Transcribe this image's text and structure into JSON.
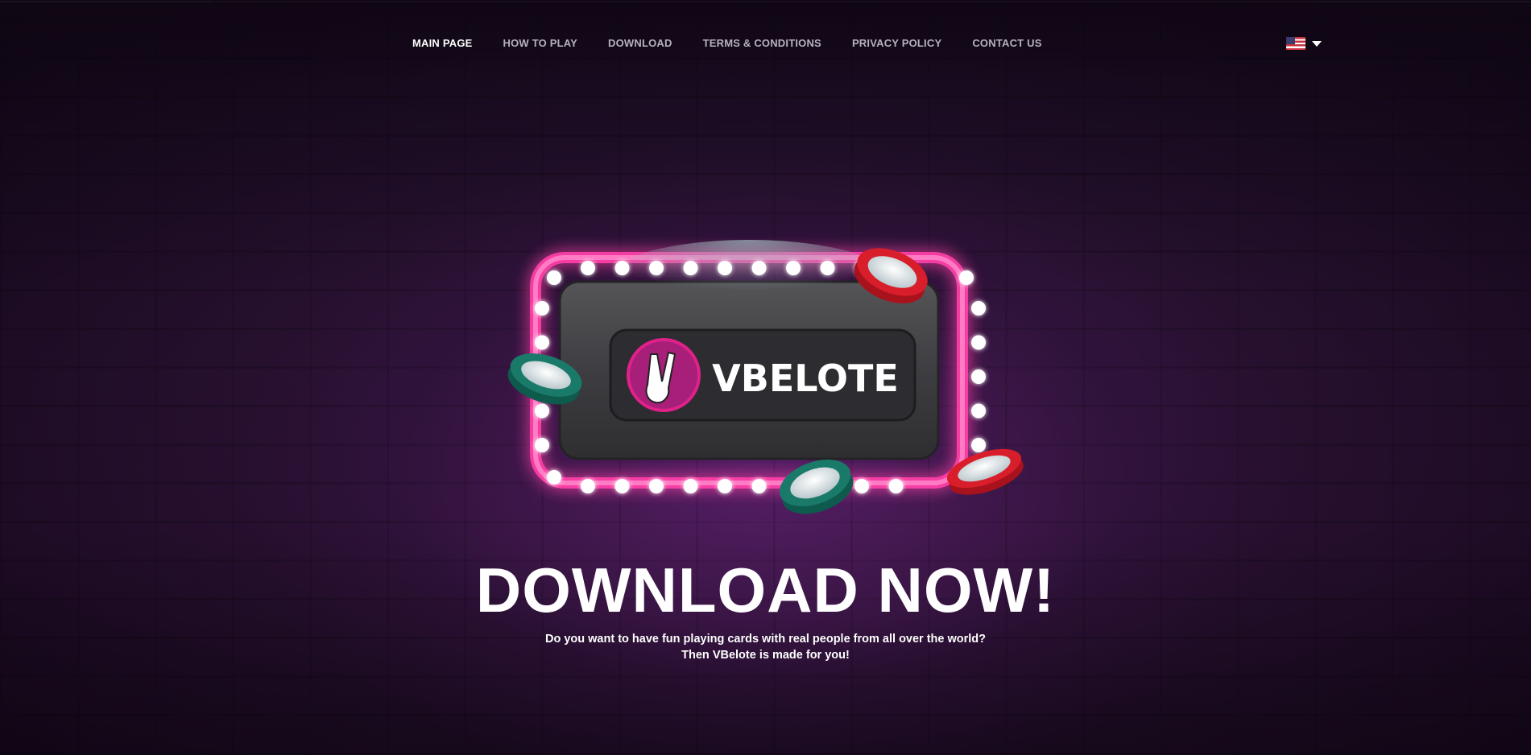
{
  "nav": {
    "items": [
      {
        "label": "MAIN PAGE",
        "active": true
      },
      {
        "label": "HOW TO PLAY",
        "active": false
      },
      {
        "label": "DOWNLOAD",
        "active": false
      },
      {
        "label": "TERMS & CONDITIONS",
        "active": false
      },
      {
        "label": "PRIVACY POLICY",
        "active": false
      },
      {
        "label": "CONTACT US",
        "active": false
      }
    ],
    "language_icon": "us-flag-icon"
  },
  "hero": {
    "logo_text": "VBELOTE",
    "headline": "DOWNLOAD NOW!",
    "subtitle_line1": "Do you want to have fun playing cards with real people from all over the world?",
    "subtitle_line2": "Then VBelote is made for you!"
  },
  "colors": {
    "accent_pink": "#e0218a",
    "background": "#2a1233",
    "chip_red": "#d81e2a",
    "chip_green": "#1a7a6a"
  }
}
